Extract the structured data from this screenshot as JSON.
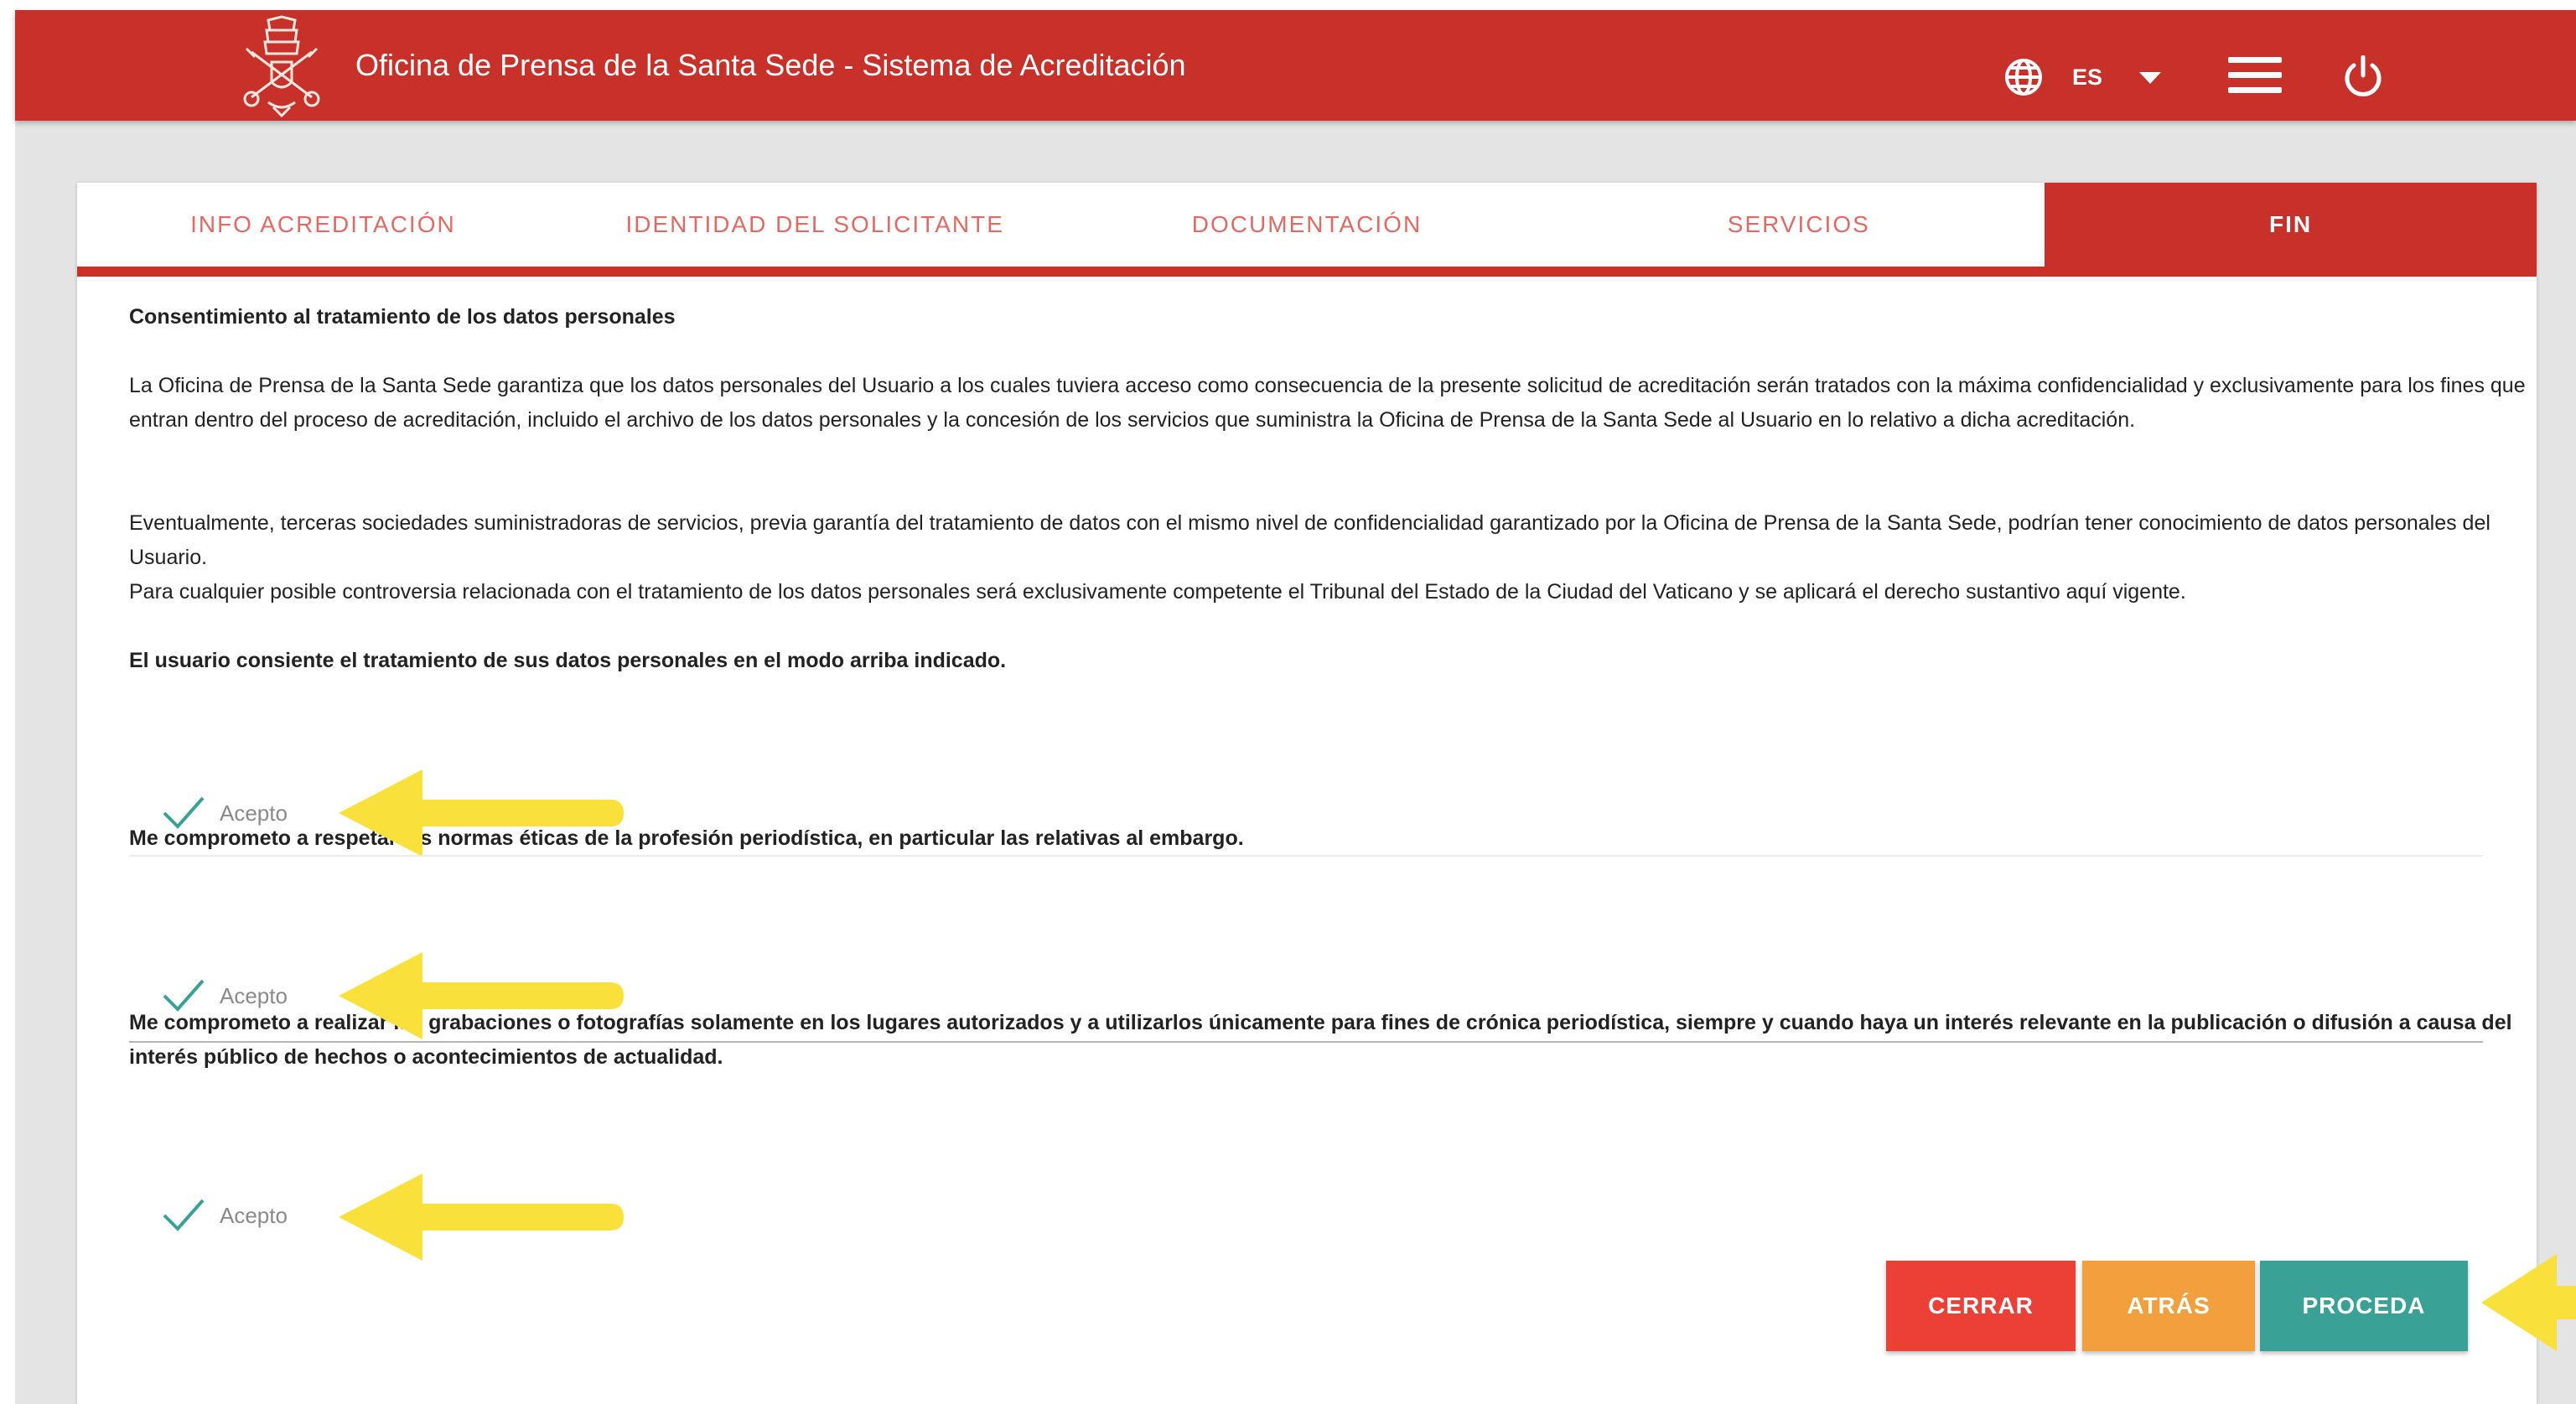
{
  "header": {
    "title": "Oficina de Prensa de la Santa Sede - Sistema de Acreditación",
    "language": "ES",
    "icons": [
      "papal-emblem-logo",
      "globe-icon",
      "caret-down-icon",
      "menu-icon",
      "power-icon"
    ]
  },
  "tabs": [
    {
      "label": "INFO ACREDITACIÓN",
      "active": false
    },
    {
      "label": "IDENTIDAD DEL SOLICITANTE",
      "active": false
    },
    {
      "label": "DOCUMENTACIÓN",
      "active": false
    },
    {
      "label": "SERVICIOS",
      "active": false
    },
    {
      "label": "FIN",
      "active": true
    }
  ],
  "consent": {
    "heading": "Consentimiento al tratamiento de los datos personales",
    "paragraph1": "La Oficina de Prensa de la Santa Sede garantiza que los datos personales del Usuario a los cuales tuviera acceso como consecuencia de la presente solicitud de acreditación serán tratados con la máxima confidencialidad y exclusivamente para los fines que entran dentro del proceso de acreditación, incluido el archivo de los datos personales y la concesión de los servicios que suministra la Oficina de Prensa de la Santa Sede al Usuario en lo relativo a dicha acreditación.",
    "paragraph2": "Eventualmente, terceras sociedades suministradoras de servicios, previa garantía del tratamiento de datos con el mismo nivel de confidencialidad garantizado por la Oficina de Prensa de la Santa Sede, podrían tener conocimiento de datos personales del Usuario.",
    "paragraph3": "Para cualquier posible controversia relacionada con el tratamiento de los datos personales será exclusivamente competente el Tribunal del Estado de la Ciudad del Vaticano y se aplicará el derecho sustantivo aquí vigente.",
    "statement": "El usuario consiente el tratamiento de sus datos personales en el modo arriba indicado.",
    "accept_label": "Acepto"
  },
  "ethics": {
    "statement": "Me comprometo a respetar las normas éticas de la profesión periodística, en particular las relativas al embargo.",
    "accept_label": "Acepto"
  },
  "recording": {
    "statement": "Me comprometo a realizar las grabaciones o fotografías solamente en los lugares autorizados y a utilizarlos únicamente para fines de crónica periodística, siempre y cuando haya un interés relevante en la publicación o difusión a causa del interés público de hechos o acontecimientos de actualidad.",
    "accept_label": "Acepto"
  },
  "buttons": {
    "close": "CERRAR",
    "back": "ATRÁS",
    "proceed": "PROCEDA"
  },
  "colors": {
    "brand_red": "#c8312a",
    "tab_text": "#e26a63",
    "check_teal": "#3aa196",
    "close_red": "#ec3f36",
    "back_orange": "#f2a03d",
    "proceed_teal": "#3aa196",
    "annotation_arrow": "#f9e03a"
  }
}
